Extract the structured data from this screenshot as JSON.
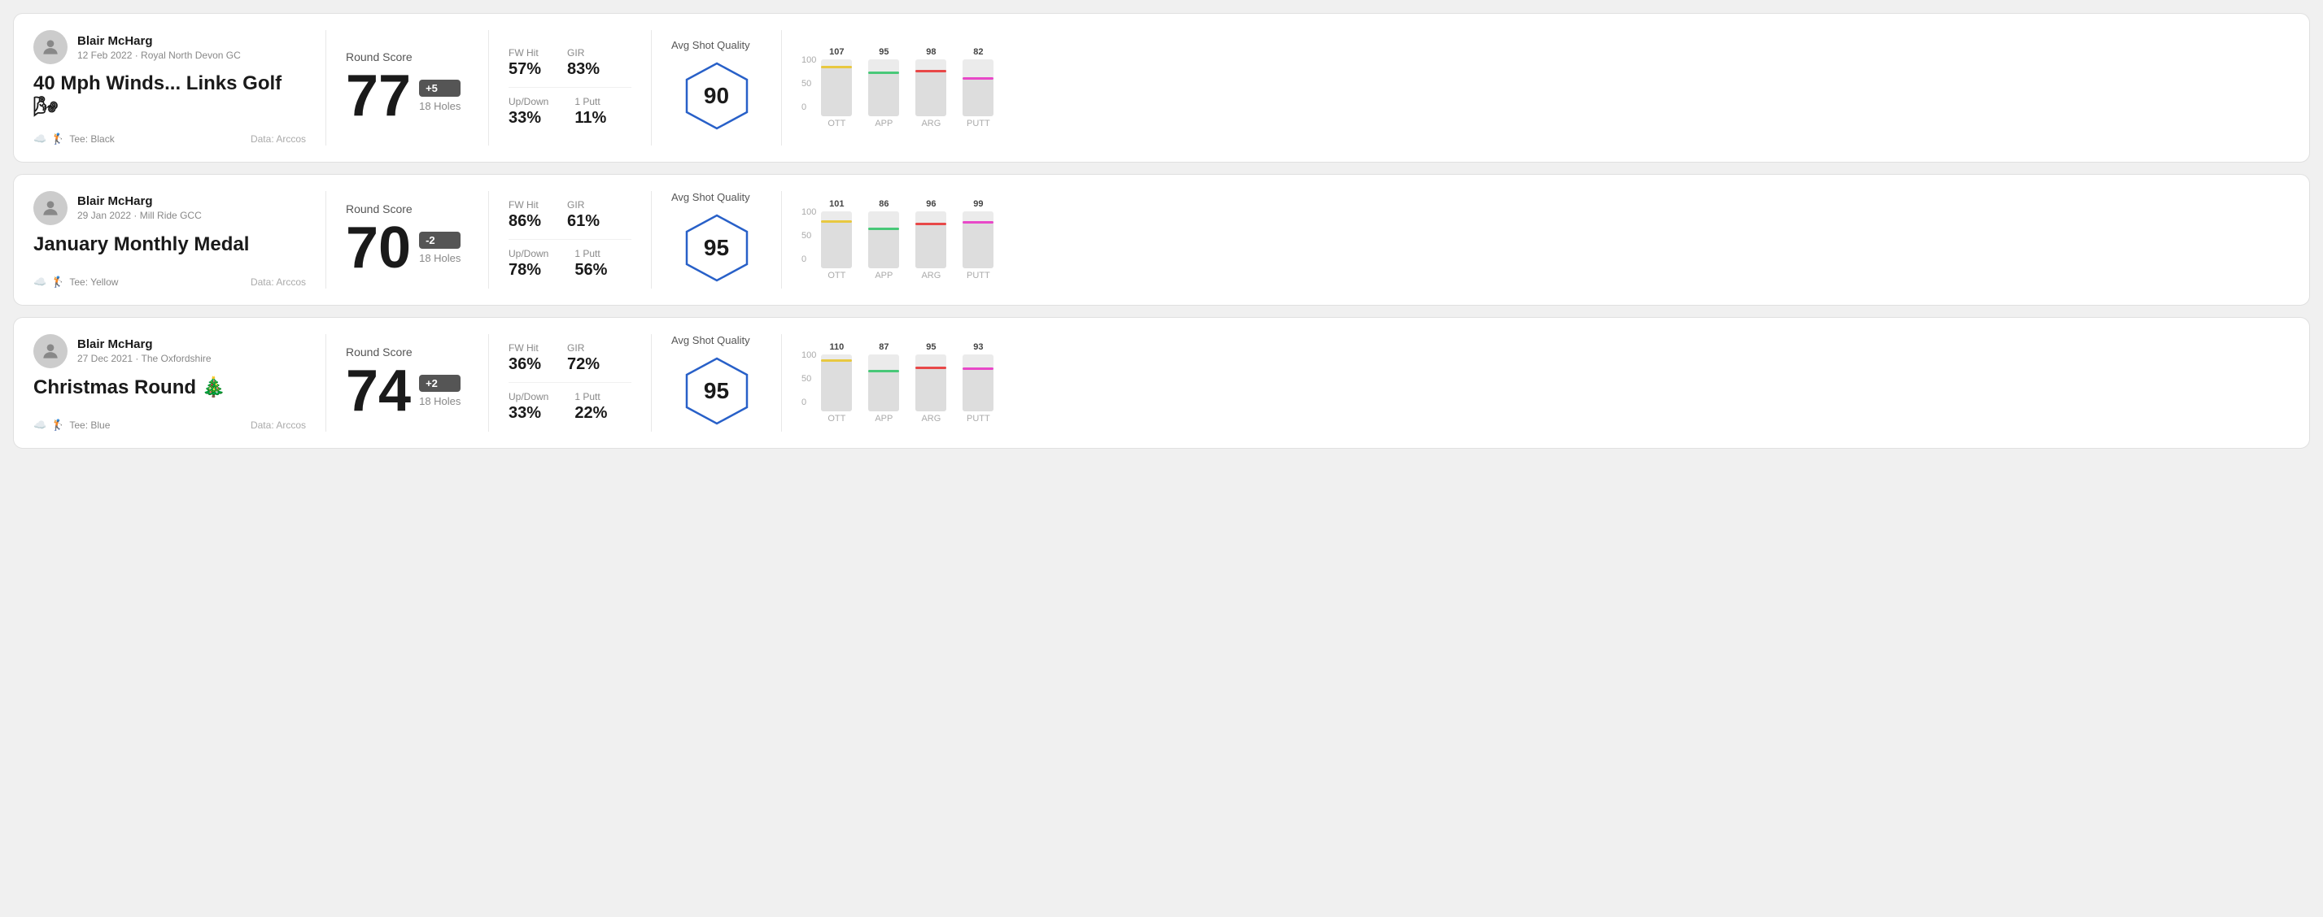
{
  "rounds": [
    {
      "id": "round-1",
      "player": "Blair McHarg",
      "date_course": "12 Feb 2022 · Royal North Devon GC",
      "title": "40 Mph Winds... Links Golf 🌬",
      "tee": "Tee: Black",
      "data_source": "Data: Arccos",
      "score": "77",
      "score_modifier": "+5",
      "score_modifier_type": "over",
      "holes": "18 Holes",
      "fw_hit": "57%",
      "gir": "83%",
      "up_down": "33%",
      "one_putt": "11%",
      "avg_shot_quality": "90",
      "chart": {
        "bars": [
          {
            "label": "OTT",
            "value": 107,
            "color": "#e8c840",
            "max": 120
          },
          {
            "label": "APP",
            "value": 95,
            "color": "#48c878",
            "max": 120
          },
          {
            "label": "ARG",
            "value": 98,
            "color": "#e84848",
            "max": 120
          },
          {
            "label": "PUTT",
            "value": 82,
            "color": "#e848c8",
            "max": 120
          }
        ]
      }
    },
    {
      "id": "round-2",
      "player": "Blair McHarg",
      "date_course": "29 Jan 2022 · Mill Ride GCC",
      "title": "January Monthly Medal",
      "tee": "Tee: Yellow",
      "data_source": "Data: Arccos",
      "score": "70",
      "score_modifier": "-2",
      "score_modifier_type": "under",
      "holes": "18 Holes",
      "fw_hit": "86%",
      "gir": "61%",
      "up_down": "78%",
      "one_putt": "56%",
      "avg_shot_quality": "95",
      "chart": {
        "bars": [
          {
            "label": "OTT",
            "value": 101,
            "color": "#e8c840",
            "max": 120
          },
          {
            "label": "APP",
            "value": 86,
            "color": "#48c878",
            "max": 120
          },
          {
            "label": "ARG",
            "value": 96,
            "color": "#e84848",
            "max": 120
          },
          {
            "label": "PUTT",
            "value": 99,
            "color": "#e848c8",
            "max": 120
          }
        ]
      }
    },
    {
      "id": "round-3",
      "player": "Blair McHarg",
      "date_course": "27 Dec 2021 · The Oxfordshire",
      "title": "Christmas Round 🎄",
      "tee": "Tee: Blue",
      "data_source": "Data: Arccos",
      "score": "74",
      "score_modifier": "+2",
      "score_modifier_type": "over",
      "holes": "18 Holes",
      "fw_hit": "36%",
      "gir": "72%",
      "up_down": "33%",
      "one_putt": "22%",
      "avg_shot_quality": "95",
      "chart": {
        "bars": [
          {
            "label": "OTT",
            "value": 110,
            "color": "#e8c840",
            "max": 120
          },
          {
            "label": "APP",
            "value": 87,
            "color": "#48c878",
            "max": 120
          },
          {
            "label": "ARG",
            "value": 95,
            "color": "#e84848",
            "max": 120
          },
          {
            "label": "PUTT",
            "value": 93,
            "color": "#e848c8",
            "max": 120
          }
        ]
      }
    }
  ],
  "labels": {
    "round_score": "Round Score",
    "fw_hit": "FW Hit",
    "gir": "GIR",
    "up_down": "Up/Down",
    "one_putt": "1 Putt",
    "avg_shot_quality": "Avg Shot Quality",
    "data_arccos": "Data: Arccos",
    "chart_y_100": "100",
    "chart_y_50": "50",
    "chart_y_0": "0"
  }
}
